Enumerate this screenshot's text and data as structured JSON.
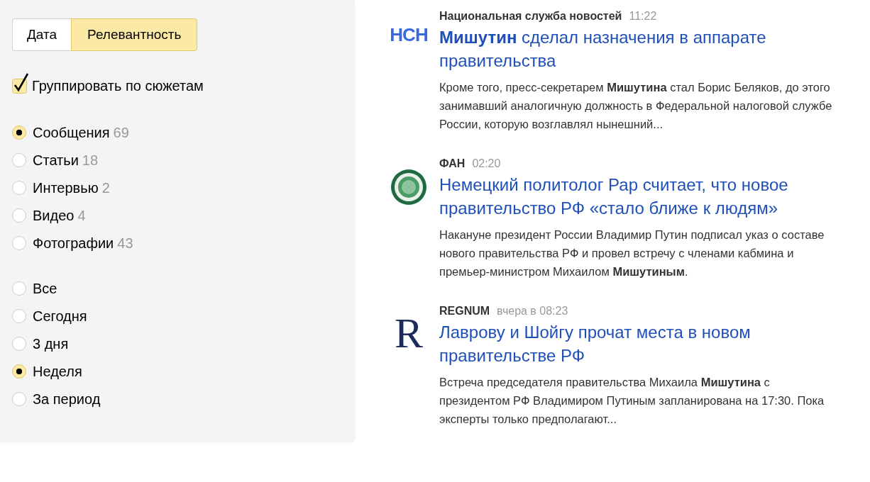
{
  "sort_tabs": [
    {
      "label": "Дата",
      "selected": false
    },
    {
      "label": "Релевантность",
      "selected": true
    }
  ],
  "group_option": {
    "label": "Группировать по сюжетам",
    "checked": true
  },
  "type_filter": [
    {
      "label": "Сообщения",
      "count": "69",
      "selected": true
    },
    {
      "label": "Статьи",
      "count": "18",
      "selected": false
    },
    {
      "label": "Интервью",
      "count": "2",
      "selected": false
    },
    {
      "label": "Видео",
      "count": "4",
      "selected": false
    },
    {
      "label": "Фотографии",
      "count": "43",
      "selected": false
    }
  ],
  "period_filter": [
    {
      "label": "Все",
      "selected": false
    },
    {
      "label": "Сегодня",
      "selected": false
    },
    {
      "label": "3 дня",
      "selected": false
    },
    {
      "label": "Неделя",
      "selected": true
    },
    {
      "label": "За период",
      "selected": false
    }
  ],
  "news": [
    {
      "logo": {
        "kind": "letters",
        "text": "НСН"
      },
      "source": "Национальная служба новостей",
      "time": "11:22",
      "title": "**Мишутин** сделал назначения в аппарате правительства",
      "snippet": "Кроме того, пресс-секретарем **Мишутина** стал Борис Беляков, до этого занимавший аналогичную должность в Федеральной налоговой службе России, которую возглавлял нынешний..."
    },
    {
      "logo": {
        "kind": "emblem"
      },
      "source": "ФАН",
      "time": "02:20",
      "title": "Немецкий политолог Рар считает, что новое правительство РФ «стало ближе к людям»",
      "snippet": "Накануне президент России Владимир Путин подписал указ о составе нового правительства РФ и провел встречу с членами кабмина и премьер-министром Михаилом **Мишутиным**."
    },
    {
      "logo": {
        "kind": "serif",
        "text": "R"
      },
      "source": "REGNUM",
      "time": "вчера в 08:23",
      "title": "Лаврову и Шойгу прочат места в новом правительстве РФ",
      "snippet": "Встреча председателя правительства Михаила **Мишутина** с президентом РФ Владимиром Путиным запланирована на 17:30. Пока эксперты только предполагают..."
    }
  ]
}
